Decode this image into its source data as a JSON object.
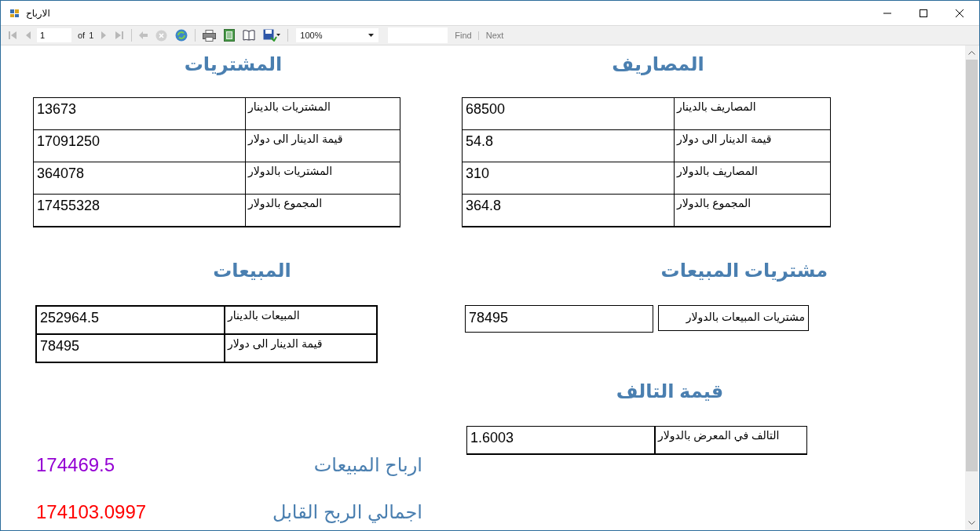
{
  "window": {
    "title": "الارباح"
  },
  "toolbar": {
    "page": "1",
    "of_label": "of",
    "page_count": "1",
    "zoom": "100%",
    "find": "Find",
    "next": "Next"
  },
  "left_sections": [
    {
      "title": "المشتريات",
      "kind": "grid",
      "rows": [
        {
          "label": "المشتريات بالدينار",
          "value": "13673"
        },
        {
          "label": "قيمة الدينار الى دولار",
          "value": "17091250"
        },
        {
          "label": "المشتريات بالدولار",
          "value": "364078"
        },
        {
          "label": "المجموع بالدولار",
          "value": "17455328"
        }
      ]
    },
    {
      "title": "المبيعات",
      "kind": "grid",
      "rows": [
        {
          "label": "المبيعات بالدينار",
          "value": "252964.5"
        },
        {
          "label": "قيمة الدينار الى دولار",
          "value": "78495"
        }
      ]
    }
  ],
  "right_sections": [
    {
      "title": "المصاريف",
      "kind": "grid",
      "rows": [
        {
          "label": "المصاريف بالدينار",
          "value": "68500"
        },
        {
          "label": "قيمة الدينار الى دولار",
          "value": "54.8"
        },
        {
          "label": "المصاريف بالدولار",
          "value": "310"
        },
        {
          "label": "المجموع بالدولار",
          "value": "364.8"
        }
      ]
    },
    {
      "title": "مشتريات المبيعات",
      "kind": "split",
      "rows": [
        {
          "label": "مشتريات المبيعات بالدولار",
          "value": "78495"
        }
      ]
    },
    {
      "title": "قيمة التالف",
      "kind": "grid",
      "rows": [
        {
          "label": "التالف في المعرض بالدولار",
          "value": "1.6003"
        }
      ]
    }
  ],
  "totals": [
    {
      "label": "ارباح المبيعات",
      "value": "174469.5",
      "color": "#9400d3"
    },
    {
      "label": "اجمالي الربح القابل",
      "value": "174103.0997",
      "color": "#ff0000"
    }
  ]
}
